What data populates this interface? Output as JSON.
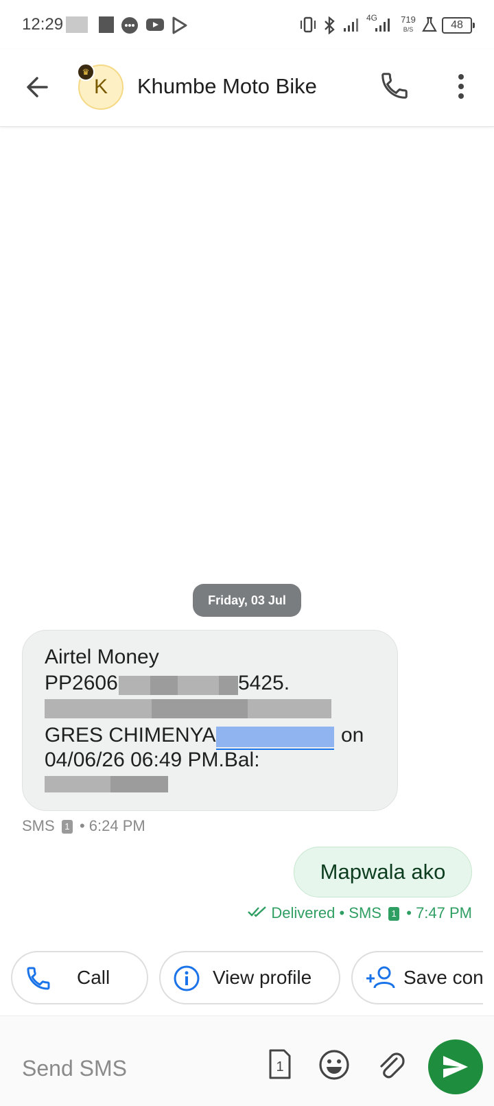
{
  "status_bar": {
    "time": "12:29",
    "signal_type": "4G",
    "speed": "719",
    "speed_unit": "B/S",
    "battery": "48",
    "icons": [
      "vibrate-icon",
      "bluetooth-icon",
      "signal-icon",
      "signal-4g-icon",
      "lab-icon",
      "battery-icon"
    ]
  },
  "header": {
    "contact_name": "Khumbe Moto Bike",
    "avatar_initial": "K",
    "back_icon": "arrow-left-icon",
    "call_icon": "phone-icon",
    "more_icon": "more-vertical-icon"
  },
  "conversation": {
    "date_chip": "Friday, 03 Jul",
    "incoming": {
      "line1": "Airtel Money",
      "line2_prefix": "PP2606",
      "line2_suffix": "5425.",
      "line4_prefix": "GRES CHIMENYA",
      "line4_suffix": "on",
      "line5": "04/06/26 06:49 PM.Bal:",
      "meta_type": "SMS",
      "meta_sim": "1",
      "meta_sep": "•",
      "meta_time": "6:24 PM"
    },
    "outgoing": {
      "text": "Mapwala ako",
      "status": "Delivered",
      "sep": "•",
      "type": "SMS",
      "sim": "1",
      "time": "7:47 PM"
    }
  },
  "actions": {
    "call_label": "Call",
    "view_profile_label": "View profile",
    "save_contact_label": "Save contact"
  },
  "composer": {
    "placeholder": "Send SMS",
    "sim_label": "1",
    "icons": [
      "sim-icon",
      "emoji-icon",
      "attach-icon",
      "send-icon"
    ]
  },
  "colors": {
    "accent_green": "#1e8e3e",
    "delivered_green": "#2f9e62",
    "link_blue": "#1a73e8",
    "outgoing_bubble": "#e7f6ec",
    "incoming_bubble": "#eff1f1"
  }
}
